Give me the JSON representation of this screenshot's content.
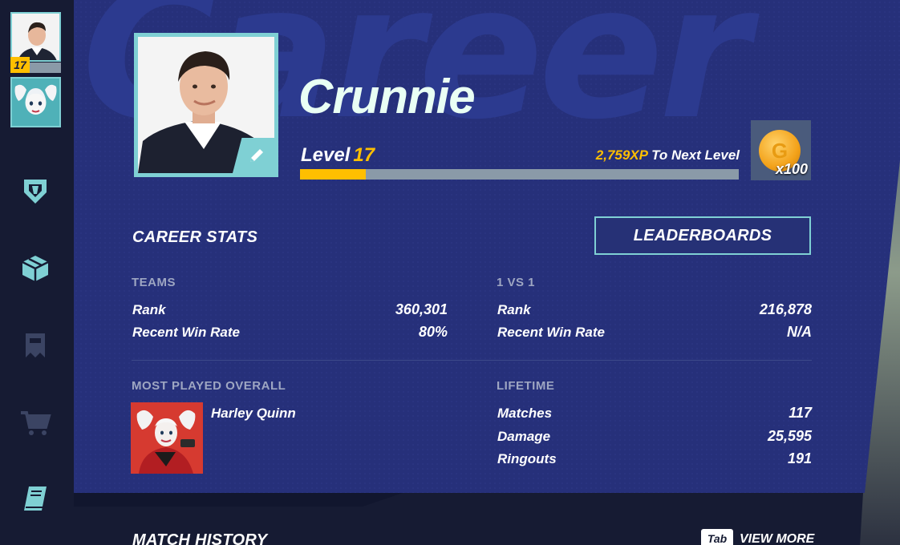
{
  "rail": {
    "player_level": "17",
    "nav": [
      "shield-nav",
      "box-nav",
      "battle-pass-nav",
      "shop-nav",
      "book-nav"
    ]
  },
  "header": {
    "watermark": "Career",
    "player_name": "Crunnie",
    "level_label": "Level",
    "level_value": "17",
    "xp_value": "2,759XP",
    "xp_suffix": "To Next Level",
    "xp_progress": 0.15,
    "reward_qty": "x100",
    "coin_letter": "G"
  },
  "career": {
    "title": "CAREER STATS",
    "leaderboards_label": "LEADERBOARDS",
    "teams": {
      "heading": "TEAMS",
      "rank_label": "Rank",
      "rank_value": "360,301",
      "winrate_label": "Recent Win Rate",
      "winrate_value": "80%"
    },
    "onevone": {
      "heading": "1 VS 1",
      "rank_label": "Rank",
      "rank_value": "216,878",
      "winrate_label": "Recent Win Rate",
      "winrate_value": "N/A"
    },
    "most_played": {
      "heading": "MOST PLAYED OVERALL",
      "character": "Harley Quinn"
    },
    "lifetime": {
      "heading": "LIFETIME",
      "matches_label": "Matches",
      "matches_value": "117",
      "damage_label": "Damage",
      "damage_value": "25,595",
      "ringouts_label": "Ringouts",
      "ringouts_value": "191"
    }
  },
  "match_history": {
    "title": "MATCH HISTORY",
    "tab_key": "Tab",
    "view_more": "VIEW MORE"
  },
  "colors": {
    "panel": "#27307a",
    "accent": "#7fd0d4",
    "gold": "#ffbf00",
    "rail": "#161b33"
  }
}
